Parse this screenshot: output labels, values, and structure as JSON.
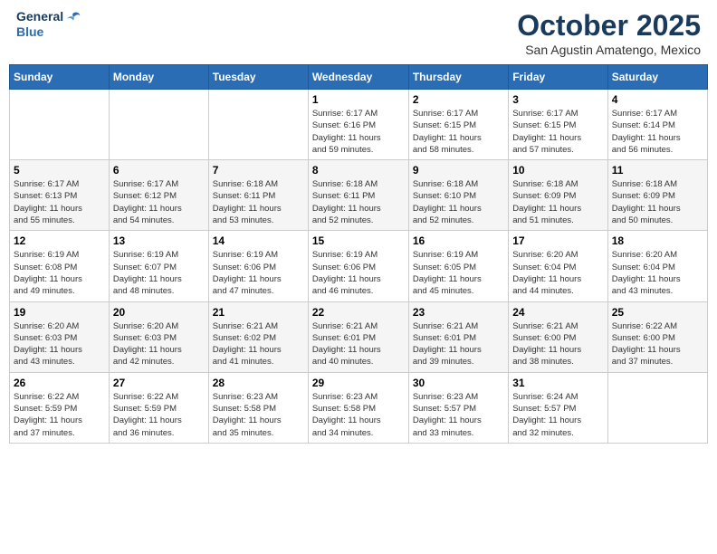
{
  "header": {
    "logo_line1": "General",
    "logo_line2": "Blue",
    "month": "October 2025",
    "location": "San Agustin Amatengo, Mexico"
  },
  "weekdays": [
    "Sunday",
    "Monday",
    "Tuesday",
    "Wednesday",
    "Thursday",
    "Friday",
    "Saturday"
  ],
  "weeks": [
    [
      {
        "day": "",
        "info": ""
      },
      {
        "day": "",
        "info": ""
      },
      {
        "day": "",
        "info": ""
      },
      {
        "day": "1",
        "info": "Sunrise: 6:17 AM\nSunset: 6:16 PM\nDaylight: 11 hours\nand 59 minutes."
      },
      {
        "day": "2",
        "info": "Sunrise: 6:17 AM\nSunset: 6:15 PM\nDaylight: 11 hours\nand 58 minutes."
      },
      {
        "day": "3",
        "info": "Sunrise: 6:17 AM\nSunset: 6:15 PM\nDaylight: 11 hours\nand 57 minutes."
      },
      {
        "day": "4",
        "info": "Sunrise: 6:17 AM\nSunset: 6:14 PM\nDaylight: 11 hours\nand 56 minutes."
      }
    ],
    [
      {
        "day": "5",
        "info": "Sunrise: 6:17 AM\nSunset: 6:13 PM\nDaylight: 11 hours\nand 55 minutes."
      },
      {
        "day": "6",
        "info": "Sunrise: 6:17 AM\nSunset: 6:12 PM\nDaylight: 11 hours\nand 54 minutes."
      },
      {
        "day": "7",
        "info": "Sunrise: 6:18 AM\nSunset: 6:11 PM\nDaylight: 11 hours\nand 53 minutes."
      },
      {
        "day": "8",
        "info": "Sunrise: 6:18 AM\nSunset: 6:11 PM\nDaylight: 11 hours\nand 52 minutes."
      },
      {
        "day": "9",
        "info": "Sunrise: 6:18 AM\nSunset: 6:10 PM\nDaylight: 11 hours\nand 52 minutes."
      },
      {
        "day": "10",
        "info": "Sunrise: 6:18 AM\nSunset: 6:09 PM\nDaylight: 11 hours\nand 51 minutes."
      },
      {
        "day": "11",
        "info": "Sunrise: 6:18 AM\nSunset: 6:09 PM\nDaylight: 11 hours\nand 50 minutes."
      }
    ],
    [
      {
        "day": "12",
        "info": "Sunrise: 6:19 AM\nSunset: 6:08 PM\nDaylight: 11 hours\nand 49 minutes."
      },
      {
        "day": "13",
        "info": "Sunrise: 6:19 AM\nSunset: 6:07 PM\nDaylight: 11 hours\nand 48 minutes."
      },
      {
        "day": "14",
        "info": "Sunrise: 6:19 AM\nSunset: 6:06 PM\nDaylight: 11 hours\nand 47 minutes."
      },
      {
        "day": "15",
        "info": "Sunrise: 6:19 AM\nSunset: 6:06 PM\nDaylight: 11 hours\nand 46 minutes."
      },
      {
        "day": "16",
        "info": "Sunrise: 6:19 AM\nSunset: 6:05 PM\nDaylight: 11 hours\nand 45 minutes."
      },
      {
        "day": "17",
        "info": "Sunrise: 6:20 AM\nSunset: 6:04 PM\nDaylight: 11 hours\nand 44 minutes."
      },
      {
        "day": "18",
        "info": "Sunrise: 6:20 AM\nSunset: 6:04 PM\nDaylight: 11 hours\nand 43 minutes."
      }
    ],
    [
      {
        "day": "19",
        "info": "Sunrise: 6:20 AM\nSunset: 6:03 PM\nDaylight: 11 hours\nand 43 minutes."
      },
      {
        "day": "20",
        "info": "Sunrise: 6:20 AM\nSunset: 6:03 PM\nDaylight: 11 hours\nand 42 minutes."
      },
      {
        "day": "21",
        "info": "Sunrise: 6:21 AM\nSunset: 6:02 PM\nDaylight: 11 hours\nand 41 minutes."
      },
      {
        "day": "22",
        "info": "Sunrise: 6:21 AM\nSunset: 6:01 PM\nDaylight: 11 hours\nand 40 minutes."
      },
      {
        "day": "23",
        "info": "Sunrise: 6:21 AM\nSunset: 6:01 PM\nDaylight: 11 hours\nand 39 minutes."
      },
      {
        "day": "24",
        "info": "Sunrise: 6:21 AM\nSunset: 6:00 PM\nDaylight: 11 hours\nand 38 minutes."
      },
      {
        "day": "25",
        "info": "Sunrise: 6:22 AM\nSunset: 6:00 PM\nDaylight: 11 hours\nand 37 minutes."
      }
    ],
    [
      {
        "day": "26",
        "info": "Sunrise: 6:22 AM\nSunset: 5:59 PM\nDaylight: 11 hours\nand 37 minutes."
      },
      {
        "day": "27",
        "info": "Sunrise: 6:22 AM\nSunset: 5:59 PM\nDaylight: 11 hours\nand 36 minutes."
      },
      {
        "day": "28",
        "info": "Sunrise: 6:23 AM\nSunset: 5:58 PM\nDaylight: 11 hours\nand 35 minutes."
      },
      {
        "day": "29",
        "info": "Sunrise: 6:23 AM\nSunset: 5:58 PM\nDaylight: 11 hours\nand 34 minutes."
      },
      {
        "day": "30",
        "info": "Sunrise: 6:23 AM\nSunset: 5:57 PM\nDaylight: 11 hours\nand 33 minutes."
      },
      {
        "day": "31",
        "info": "Sunrise: 6:24 AM\nSunset: 5:57 PM\nDaylight: 11 hours\nand 32 minutes."
      },
      {
        "day": "",
        "info": ""
      }
    ]
  ]
}
